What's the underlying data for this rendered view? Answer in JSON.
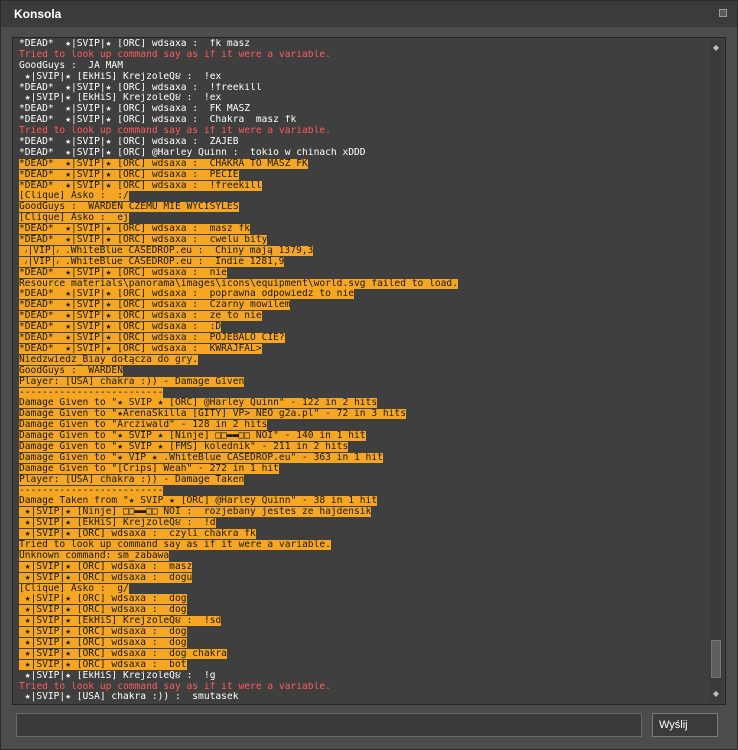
{
  "window": {
    "title": "Konsola"
  },
  "console": {
    "lines": [
      {
        "text": "*DEAD*  ★|SVIP|★ [ORC] wdsaxa :  fk masz",
        "style": "normal"
      },
      {
        "text": "Tried to look up command say as if it were a variable.",
        "style": "error"
      },
      {
        "text": "GoodGuys :  JA MAM",
        "style": "normal"
      },
      {
        "text": " ★|SVIP|★ [EkHiS] KrejzoleQ૪ :  !ex",
        "style": "normal"
      },
      {
        "text": "*DEAD*  ★|SVIP|★ [ORC] wdsaxa :  !freekill",
        "style": "normal"
      },
      {
        "text": " ★|SVIP|★ [EkHiS] KrejzoleQ૪ :  !ex",
        "style": "normal"
      },
      {
        "text": "*DEAD*  ★|SVIP|★ [ORC] wdsaxa :  FK MASZ",
        "style": "normal"
      },
      {
        "text": "*DEAD*  ★|SVIP|★ [ORC] wdsaxa :  Chakra  masz fk",
        "style": "normal"
      },
      {
        "text": "Tried to look up command say as if it were a variable.",
        "style": "error"
      },
      {
        "text": "*DEAD*  ★|SVIP|★ [ORC] wdsaxa :  ZAJEB",
        "style": "normal"
      },
      {
        "text": "*DEAD*  ★|SVIP|★ [ORC] @Harley Quinn :  tokio w chinach xDDD",
        "style": "normal"
      },
      {
        "text": "*DEAD*  ★|SVIP|★ [ORC] wdsaxa :  CHAKRA TO MASZ FK",
        "style": "hl"
      },
      {
        "text": "*DEAD*  ★|SVIP|★ [ORC] wdsaxa :  PECIE",
        "style": "hl"
      },
      {
        "text": "*DEAD*  ★|SVIP|★ [ORC] wdsaxa :  !freekill",
        "style": "hl"
      },
      {
        "text": "[Clique] Asko :  :/",
        "style": "hl"
      },
      {
        "text": "GoodGuys :  WARDEN CZEMU MIE WYCISYLES",
        "style": "hl"
      },
      {
        "text": "[Clique] Asko :  ej",
        "style": "hl"
      },
      {
        "text": "*DEAD*  ★|SVIP|★ [ORC] wdsaxa :  masz fk",
        "style": "hl"
      },
      {
        "text": "*DEAD*  ★|SVIP|★ [ORC] wdsaxa :  cwelu bity",
        "style": "hl"
      },
      {
        "text": " ៸|VIP|៸ .WhiteBlue CASEDROP.eu :  Chiny mają 1379,3",
        "style": "hl"
      },
      {
        "text": " ៸|VIP|៸ .WhiteBlue CASEDROP.eu :  Indie 1281,9",
        "style": "hl"
      },
      {
        "text": "*DEAD*  ★|SVIP|★ [ORC] wdsaxa :  nie",
        "style": "hl"
      },
      {
        "text": "Resource materials\\panorama\\images\\icons\\equipment\\world.svg failed to load.",
        "style": "hl"
      },
      {
        "text": "*DEAD*  ★|SVIP|★ [ORC] wdsaxa :  poprawna odpowiedz to nie",
        "style": "hl"
      },
      {
        "text": "*DEAD*  ★|SVIP|★ [ORC] wdsaxa :  Czarny mowilem",
        "style": "hl"
      },
      {
        "text": "*DEAD*  ★|SVIP|★ [ORC] wdsaxa :  ze to nie",
        "style": "hl"
      },
      {
        "text": "*DEAD*  ★|SVIP|★ [ORC] wdsaxa :  :D",
        "style": "hl"
      },
      {
        "text": "*DEAD*  ★|SVIP|★ [ORC] wdsaxa :  POJEBALO CIE?",
        "style": "hl"
      },
      {
        "text": "*DEAD*  ★|SVIP|★ [ORC] wdsaxa :  KWRAJFAL>",
        "style": "hl"
      },
      {
        "text": "Niedzwiedz_Biay dołącza do gry.",
        "style": "hl"
      },
      {
        "text": "GoodGuys :  WARDEN",
        "style": "hl"
      },
      {
        "text": "Player: [USA] chakra :)) - Damage Given",
        "style": "hl"
      },
      {
        "text": "-------------------------",
        "style": "hl"
      },
      {
        "text": "Damage Given to \"★ SVIP ★ [ORC] @Harley Quinn\" - 122 in 2 hits",
        "style": "hl"
      },
      {
        "text": "Damage Given to \"★ArenaSkilla [GITY] VP> NEO g2a.pl\" - 72 in 3 hits",
        "style": "hl"
      },
      {
        "text": "Damage Given to \"Arcziwald\" - 128 in 2 hits",
        "style": "hl"
      },
      {
        "text": "Damage Given to \"★ SVIP ★ [Ninje] □□▬▬□□ NOI\" - 140 in 1 hit",
        "style": "hl"
      },
      {
        "text": "Damage Given to \"★ SVIP ★ [FMS] kolednik\" - 211 in 2 hits",
        "style": "hl"
      },
      {
        "text": "Damage Given to \"★ VIP ★ .WhiteBlue CASEDROP.eu\" - 363 in 1 hit",
        "style": "hl"
      },
      {
        "text": "Damage Given to \"[Crips] Weah\" - 272 in 1 hit",
        "style": "hl"
      },
      {
        "text": "Player: [USA] chakra :)) - Damage Taken",
        "style": "hl"
      },
      {
        "text": "-------------------------",
        "style": "hl"
      },
      {
        "text": "Damage Taken from \"★ SVIP ★ [ORC] @Harley Quinn\" - 38 in 1 hit",
        "style": "hl"
      },
      {
        "text": " ★|SVIP|★ [Ninje] □□▬▬□□ NOI :  rozjebany jestes ze hajdensik",
        "style": "hl"
      },
      {
        "text": " ★|SVIP|★ [EkHiS] KrejzoleQ૪ :  !d",
        "style": "hl"
      },
      {
        "text": " ★|SVIP|★ [ORC] wdsaxa :  czyli chakra fk",
        "style": "hl"
      },
      {
        "text": "Tried to look up command say as if it were a variable.",
        "style": "hl"
      },
      {
        "text": "Unknown command: sm_zabawa",
        "style": "hl"
      },
      {
        "text": " ★|SVIP|★ [ORC] wdsaxa :  masz",
        "style": "hl"
      },
      {
        "text": " ★|SVIP|★ [ORC] wdsaxa :  dogu",
        "style": "hl"
      },
      {
        "text": "[Clique] Asko :  g/",
        "style": "hl"
      },
      {
        "text": " ★|SVIP|★ [ORC] wdsaxa :  dog",
        "style": "hl"
      },
      {
        "text": " ★|SVIP|★ [ORC] wdsaxa :  dog",
        "style": "hl"
      },
      {
        "text": " ★|SVIP|★ [EkHiS] KrejzoleQ૪ :  !sd",
        "style": "hl"
      },
      {
        "text": " ★|SVIP|★ [ORC] wdsaxa :  dog",
        "style": "hl"
      },
      {
        "text": " ★|SVIP|★ [ORC] wdsaxa :  dog",
        "style": "hl"
      },
      {
        "text": " ★|SVIP|★ [ORC] wdsaxa :  dog chakra",
        "style": "hl"
      },
      {
        "text": " ★|SVIP|★ [ORC] wdsaxa :  bot",
        "style": "hl"
      },
      {
        "text": " ★|SVIP|★ [EkHiS] KrejzoleQ૪ :  !g",
        "style": "normal"
      },
      {
        "text": "Tried to look up command say as if it were a variable.",
        "style": "error"
      },
      {
        "text": " ★|SVIP|★ [USA] chakra :)) :  smutasek",
        "style": "normal"
      }
    ]
  },
  "input": {
    "value": "",
    "placeholder": ""
  },
  "send_button": {
    "label": "Wyślij"
  },
  "icons": {
    "title_button": "restore-icon",
    "scroll_up": "arrow-up-icon",
    "scroll_down": "arrow-down-icon"
  },
  "colors": {
    "highlight": "#f5a623",
    "error": "#ff5a5a",
    "text": "#ffffff"
  }
}
